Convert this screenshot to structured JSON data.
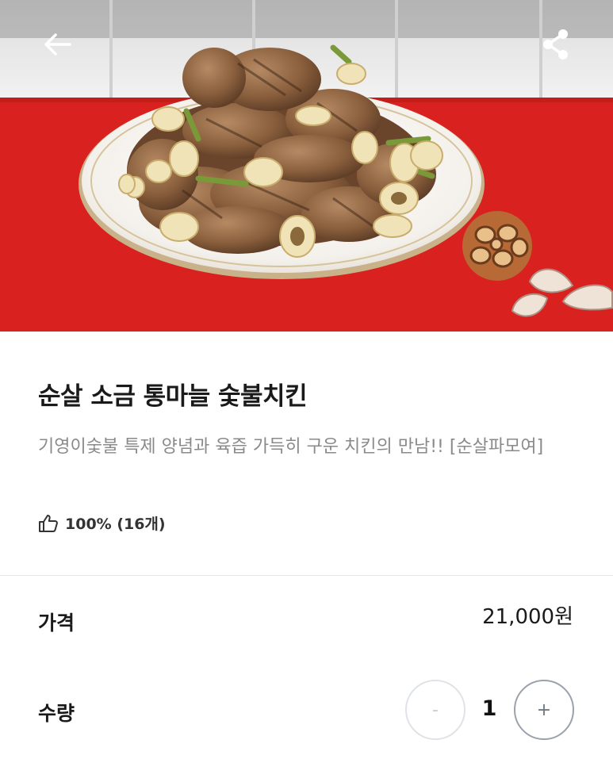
{
  "header": {
    "back_icon": "arrow-left-icon",
    "share_icon": "share-icon"
  },
  "hero": {
    "image": "garlic-salt-grilled-chicken-photo"
  },
  "product": {
    "title": "순살 소금 통마늘 숯불치킨",
    "description": "기영이숯불 특제 양념과 육즙 가득히 구운 치킨의 만남!! [순살파모여]",
    "rating_icon": "thumbs-up-icon",
    "rating_text": "100% (16개)"
  },
  "price": {
    "label": "가격",
    "value": "21,000원"
  },
  "quantity": {
    "label": "수량",
    "minus": "-",
    "value": "1",
    "plus": "+"
  },
  "colors": {
    "tablecloth_red": "#d9211f",
    "text_primary": "#1a1a1a",
    "text_secondary": "#8a8a8a",
    "divider": "#e6e6e6"
  }
}
